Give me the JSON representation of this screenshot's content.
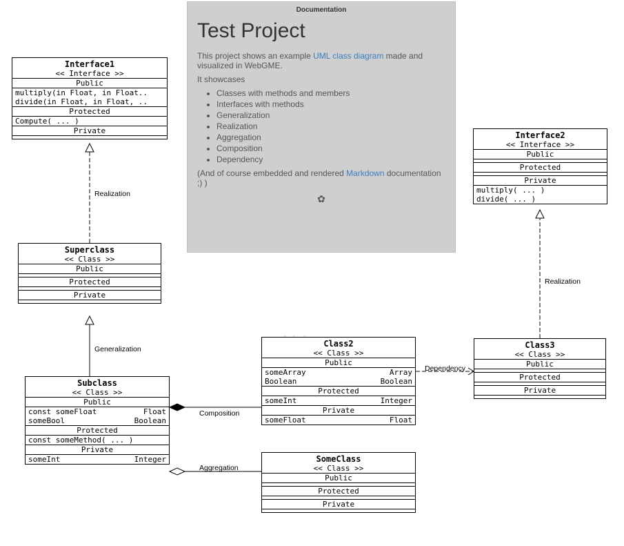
{
  "watermark": "ALL",
  "doc": {
    "header": "Documentation",
    "title": "Test Project",
    "intro_before": "This project shows an example ",
    "intro_link": "UML class diagram",
    "intro_after": " made and visualized in WebGME.",
    "showcases_label": "It showcases",
    "items": [
      "Classes with methods and members",
      "Interfaces with methods",
      "Generalization",
      "Realization",
      "Aggregation",
      "Composition",
      "Dependency"
    ],
    "footer_before": "(And of course embedded and rendered ",
    "footer_link": "Markdown",
    "footer_after": " documentation ;) )"
  },
  "labels": {
    "public": "Public",
    "protected": "Protected",
    "private": "Private"
  },
  "edges": {
    "realization1": "Realization",
    "generalization": "Generalization",
    "composition": "Composition",
    "aggregation": "Aggregation",
    "dependency": "Dependency",
    "realization2": "Realization"
  },
  "interface1": {
    "name": "Interface1",
    "stereo": "<< Interface >>",
    "public1": "multiply(in Float, in Float..",
    "public2": "divide(in Float, in Float, ..",
    "protected1": "Compute( ... )"
  },
  "superclass": {
    "name": "Superclass",
    "stereo": "<< Class >>"
  },
  "subclass": {
    "name": "Subclass",
    "stereo": "<< Class >>",
    "pub_l1": "const someFloat",
    "pub_r1": "Float",
    "pub_l2": "someBool",
    "pub_r2": "Boolean",
    "prot1": "const someMethod( ... )",
    "priv_l1": "someInt",
    "priv_r1": "Integer"
  },
  "class2": {
    "name": "Class2",
    "stereo": "<< Class >>",
    "pub_l1": "someArray",
    "pub_r1": "Array",
    "pub_l2": "Boolean",
    "pub_r2": "Boolean",
    "prot_l1": "someInt",
    "prot_r1": "Integer",
    "priv_l1": "someFloat",
    "priv_r1": "Float"
  },
  "someclass": {
    "name": "SomeClass",
    "stereo": "<< Class >>"
  },
  "interface2": {
    "name": "Interface2",
    "stereo": "<< Interface >>",
    "priv1": "multiply( ... )",
    "priv2": "divide( ... )"
  },
  "class3": {
    "name": "Class3",
    "stereo": "<< Class >>"
  }
}
